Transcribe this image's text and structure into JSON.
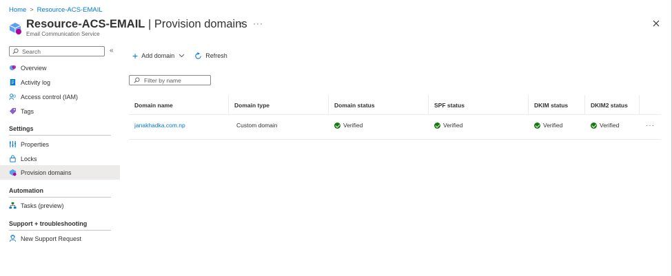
{
  "breadcrumb": {
    "home": "Home",
    "separator": ">",
    "current": "Resource-ACS-EMAIL"
  },
  "header": {
    "resource_name": "Resource-ACS-EMAIL",
    "page_name": " | Provision domains",
    "subtitle": "Email Communication Service",
    "icons": {
      "favorite": "star-icon",
      "more": "ellipsis-icon",
      "close": "close-icon"
    }
  },
  "sidebar": {
    "search_placeholder": "Search",
    "collapse_glyph": "«",
    "items": [
      {
        "label": "Overview",
        "icon": "overview-icon"
      },
      {
        "label": "Activity log",
        "icon": "activity-log-icon"
      },
      {
        "label": "Access control (IAM)",
        "icon": "iam-icon"
      },
      {
        "label": "Tags",
        "icon": "tag-icon"
      }
    ],
    "groups": [
      {
        "title": "Settings",
        "items": [
          {
            "label": "Properties",
            "icon": "properties-icon"
          },
          {
            "label": "Locks",
            "icon": "lock-icon"
          },
          {
            "label": "Provision domains",
            "icon": "provision-domains-icon",
            "active": true
          }
        ]
      },
      {
        "title": "Automation",
        "items": [
          {
            "label": "Tasks (preview)",
            "icon": "tasks-icon"
          }
        ]
      },
      {
        "title": "Support + troubleshooting",
        "items": [
          {
            "label": "New Support Request",
            "icon": "support-icon"
          }
        ]
      }
    ]
  },
  "toolbar": {
    "add_domain": "Add domain",
    "refresh": "Refresh"
  },
  "filter": {
    "placeholder": "Filter by name"
  },
  "table": {
    "columns": [
      "Domain name",
      "Domain type",
      "Domain status",
      "SPF status",
      "DKIM status",
      "DKIM2 status"
    ],
    "rows": [
      {
        "domain_name": "janakhadka.com.np",
        "domain_type": "Custom domain",
        "domain_status": "Verified",
        "spf_status": "Verified",
        "dkim_status": "Verified",
        "dkim2_status": "Verified"
      }
    ]
  },
  "colors": {
    "accent": "#0078d4",
    "success": "#107c10",
    "active_bg": "#edebe9"
  }
}
